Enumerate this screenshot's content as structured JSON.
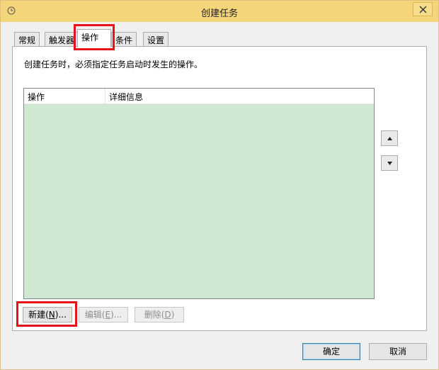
{
  "window": {
    "title": "创建任务",
    "title_bar_color": "#f5d57a"
  },
  "tabs": [
    {
      "label": "常规"
    },
    {
      "label": "触发器"
    },
    {
      "label": "操作",
      "active": true
    },
    {
      "label": "条件"
    },
    {
      "label": "设置"
    }
  ],
  "panel": {
    "description": "创建任务时，必须指定任务启动时发生的操作。",
    "list": {
      "columns": [
        "操作",
        "详细信息"
      ],
      "rows": [],
      "background_color": "#cfe8d1"
    }
  },
  "actions": {
    "new_prefix": "新建(",
    "new_key": "N",
    "new_suffix": ")...",
    "edit_prefix": "编辑(",
    "edit_key": "E",
    "edit_suffix": ")...",
    "delete_prefix": "删除(",
    "delete_key": "D",
    "delete_suffix": ")"
  },
  "footer": {
    "ok_label": "确定",
    "cancel_label": "取消"
  },
  "icons": {
    "title": "clock-icon",
    "close": "close-icon",
    "move_up": "triangle-up-icon",
    "move_down": "triangle-down-icon"
  },
  "highlight_color": "#e8121c"
}
